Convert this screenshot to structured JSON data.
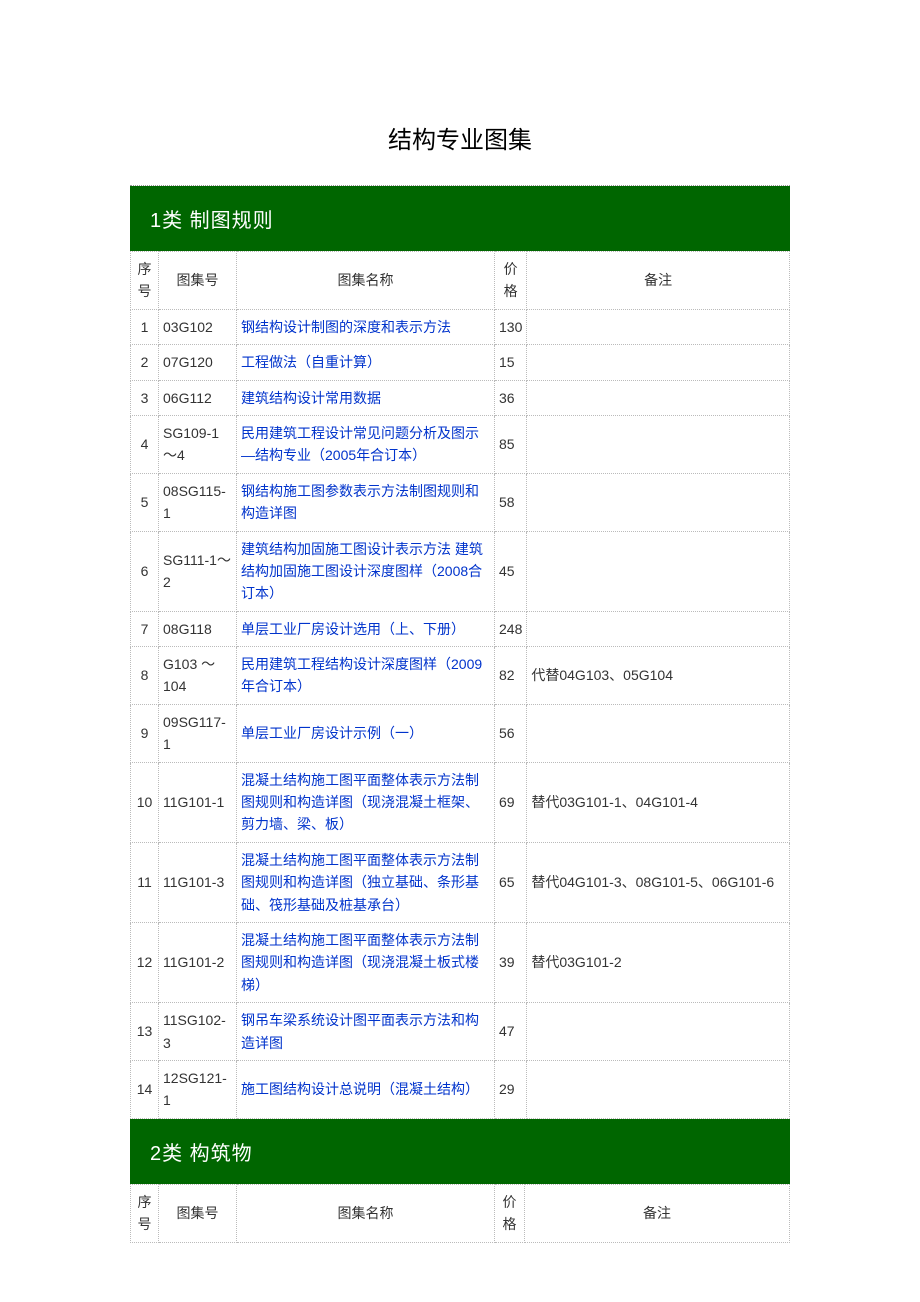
{
  "title": "结构专业图集",
  "categories": [
    {
      "header": "1类  制图规则",
      "columns": {
        "seq": "序号",
        "code": "图集号",
        "name": "图集名称",
        "price": "价格",
        "remarks": "备注"
      },
      "rows": [
        {
          "seq": "1",
          "code": "03G102",
          "name": "钢结构设计制图的深度和表示方法",
          "price": "130",
          "remarks": ""
        },
        {
          "seq": "2",
          "code": "07G120",
          "name": "工程做法（自重计算）",
          "price": "15",
          "remarks": ""
        },
        {
          "seq": "3",
          "code": "06G112",
          "name": "建筑结构设计常用数据",
          "price": "36",
          "remarks": ""
        },
        {
          "seq": "4",
          "code": "SG109-1～4",
          "name": "民用建筑工程设计常见问题分析及图示—结构专业（2005年合订本）",
          "price": "85",
          "remarks": ""
        },
        {
          "seq": "5",
          "code": "08SG115-1",
          "name": "钢结构施工图参数表示方法制图规则和构造详图",
          "price": "58",
          "remarks": ""
        },
        {
          "seq": "6",
          "code": "SG111-1～2",
          "name": "建筑结构加固施工图设计表示方法  建筑结构加固施工图设计深度图样（2008合订本）",
          "price": "45",
          "remarks": ""
        },
        {
          "seq": "7",
          "code": "08G118",
          "name": "单层工业厂房设计选用（上、下册）",
          "price": "248",
          "remarks": ""
        },
        {
          "seq": "8",
          "code": "G103 ～ 104",
          "name": "民用建筑工程结构设计深度图样（2009年合订本）",
          "price": "82",
          "remarks": "代替04G103、05G104"
        },
        {
          "seq": "9",
          "code": "09SG117-1",
          "name": "单层工业厂房设计示例（一）",
          "price": "56",
          "remarks": ""
        },
        {
          "seq": "10",
          "code": "11G101-1",
          "name": "混凝土结构施工图平面整体表示方法制图规则和构造详图（现浇混凝土框架、剪力墙、梁、板）",
          "price": "69",
          "remarks": "替代03G101-1、04G101-4"
        },
        {
          "seq": "11",
          "code": "11G101-3",
          "name": "混凝土结构施工图平面整体表示方法制图规则和构造详图（独立基础、条形基础、筏形基础及桩基承台）",
          "price": "65",
          "remarks": "替代04G101-3、08G101-5、06G101-6"
        },
        {
          "seq": "12",
          "code": "11G101-2",
          "name": "混凝土结构施工图平面整体表示方法制图规则和构造详图（现浇混凝土板式楼梯）",
          "price": "39",
          "remarks": "替代03G101-2"
        },
        {
          "seq": "13",
          "code": "11SG102-3",
          "name": "钢吊车梁系统设计图平面表示方法和构造详图",
          "price": "47",
          "remarks": ""
        },
        {
          "seq": "14",
          "code": "12SG121-1",
          "name": "施工图结构设计总说明（混凝土结构）",
          "price": "29",
          "remarks": ""
        }
      ]
    },
    {
      "header": "2类  构筑物",
      "columns": {
        "seq": "序号",
        "code": "图集号",
        "name": "图集名称",
        "price": "价格",
        "remarks": "备注"
      },
      "rows": []
    }
  ]
}
